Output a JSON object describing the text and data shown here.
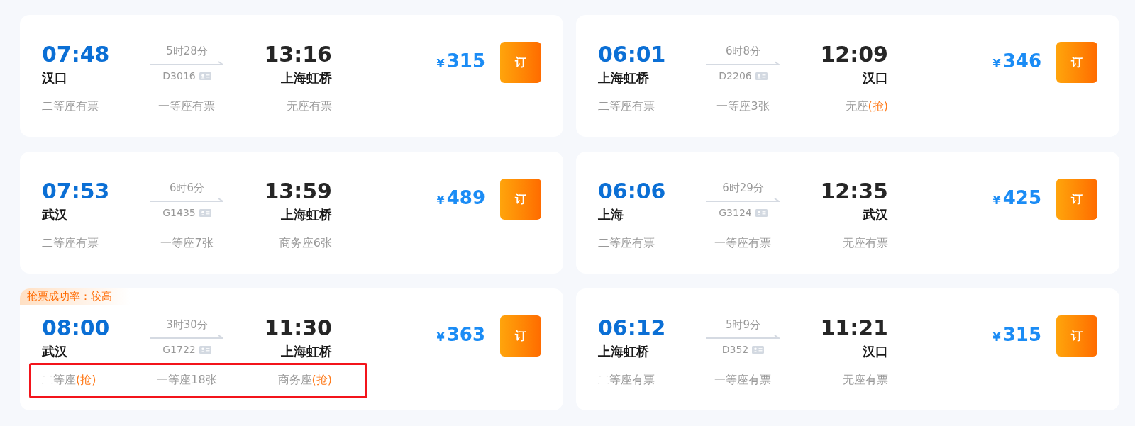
{
  "trains": [
    {
      "depart_time": "07:48",
      "depart_station": "汉口",
      "duration": "5时28分",
      "train_no": "D3016",
      "arrive_time": "13:16",
      "arrive_station": "上海虹桥",
      "currency": "¥",
      "price": "315",
      "book_label": "订",
      "seats_outlined": false,
      "seats": [
        {
          "label": "二等座",
          "status": "有票",
          "highlighted": false
        },
        {
          "label": "一等座",
          "status": "有票",
          "highlighted": false
        },
        {
          "label": "无座",
          "status": "有票",
          "highlighted": false
        }
      ]
    },
    {
      "depart_time": "06:01",
      "depart_station": "上海虹桥",
      "duration": "6时8分",
      "train_no": "D2206",
      "arrive_time": "12:09",
      "arrive_station": "汉口",
      "currency": "¥",
      "price": "346",
      "book_label": "订",
      "seats_outlined": false,
      "seats": [
        {
          "label": "二等座",
          "status": "有票",
          "highlighted": false
        },
        {
          "label": "一等座",
          "status": "3张",
          "highlighted": false
        },
        {
          "label": "无座",
          "status": "(抢)",
          "highlighted": true
        }
      ]
    },
    {
      "depart_time": "07:53",
      "depart_station": "武汉",
      "duration": "6时6分",
      "train_no": "G1435",
      "arrive_time": "13:59",
      "arrive_station": "上海虹桥",
      "currency": "¥",
      "price": "489",
      "book_label": "订",
      "seats_outlined": false,
      "seats": [
        {
          "label": "二等座",
          "status": "有票",
          "highlighted": false
        },
        {
          "label": "一等座",
          "status": "7张",
          "highlighted": false
        },
        {
          "label": "商务座",
          "status": "6张",
          "highlighted": false
        }
      ]
    },
    {
      "depart_time": "06:06",
      "depart_station": "上海",
      "duration": "6时29分",
      "train_no": "G3124",
      "arrive_time": "12:35",
      "arrive_station": "武汉",
      "currency": "¥",
      "price": "425",
      "book_label": "订",
      "seats_outlined": false,
      "seats": [
        {
          "label": "二等座",
          "status": "有票",
          "highlighted": false
        },
        {
          "label": "一等座",
          "status": "有票",
          "highlighted": false
        },
        {
          "label": "无座",
          "status": "有票",
          "highlighted": false
        }
      ]
    },
    {
      "badge": "抢票成功率：较高",
      "depart_time": "08:00",
      "depart_station": "武汉",
      "duration": "3时30分",
      "train_no": "G1722",
      "arrive_time": "11:30",
      "arrive_station": "上海虹桥",
      "currency": "¥",
      "price": "363",
      "book_label": "订",
      "seats_outlined": true,
      "seats": [
        {
          "label": "二等座",
          "status": "(抢)",
          "highlighted": true
        },
        {
          "label": "一等座",
          "status": "18张",
          "highlighted": false
        },
        {
          "label": "商务座",
          "status": "(抢)",
          "highlighted": true
        }
      ]
    },
    {
      "depart_time": "06:12",
      "depart_station": "上海虹桥",
      "duration": "5时9分",
      "train_no": "D352",
      "arrive_time": "11:21",
      "arrive_station": "汉口",
      "currency": "¥",
      "price": "315",
      "book_label": "订",
      "seats_outlined": false,
      "seats": [
        {
          "label": "二等座",
          "status": "有票",
          "highlighted": false
        },
        {
          "label": "一等座",
          "status": "有票",
          "highlighted": false
        },
        {
          "label": "无座",
          "status": "有票",
          "highlighted": false
        }
      ]
    }
  ]
}
